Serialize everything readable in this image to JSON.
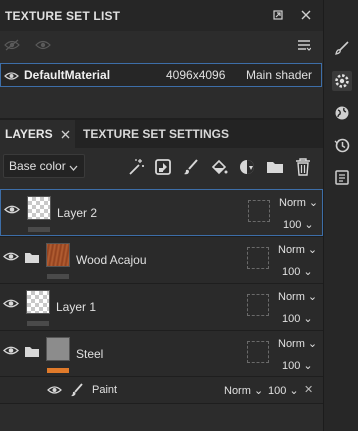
{
  "texture_set_list": {
    "title": "TEXTURE SET LIST",
    "rows": [
      {
        "name": "DefaultMaterial",
        "resolution": "4096x4096",
        "shader": "Main shader"
      }
    ]
  },
  "tabs": [
    {
      "label": "LAYERS"
    },
    {
      "label": "TEXTURE SET SETTINGS"
    }
  ],
  "channel_select": {
    "value": "Base color"
  },
  "layers": [
    {
      "name": "Layer 2",
      "blend": "Norm",
      "opacity": "100"
    },
    {
      "name": "Wood Acajou",
      "blend": "Norm",
      "opacity": "100"
    },
    {
      "name": "Layer 1",
      "blend": "Norm",
      "opacity": "100"
    },
    {
      "name": "Steel",
      "blend": "Norm",
      "opacity": "100"
    }
  ],
  "effect": {
    "name": "Paint",
    "blend": "Norm",
    "opacity": "100"
  },
  "icons": {
    "strip": [
      "brush-icon",
      "gear-icon",
      "globe-icon",
      "history-icon",
      "clipboard-icon"
    ],
    "toolbar": [
      "magic-wand-icon",
      "add-layer-icon",
      "paint-brush-icon",
      "fill-bucket-icon",
      "mask-icon",
      "folder-icon",
      "trash-icon"
    ]
  },
  "colors": {
    "selection_border": "#3d6ea8",
    "steel_accent": "#e07a2a",
    "panel_bg": "#2c2c2c"
  }
}
